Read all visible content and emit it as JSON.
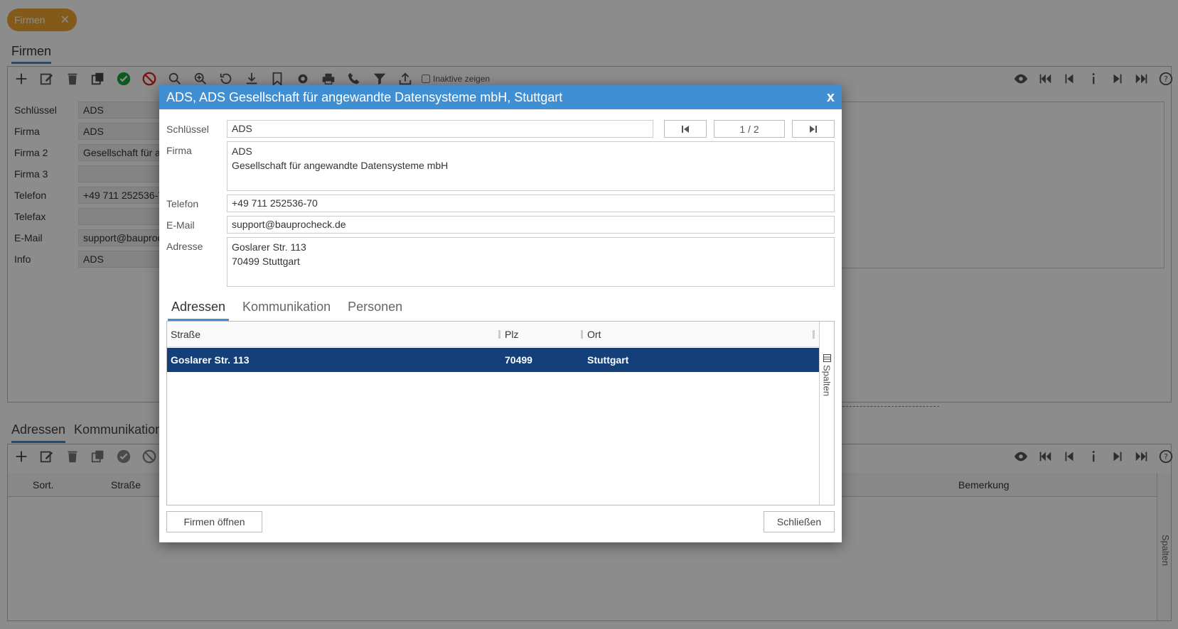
{
  "app": {
    "chip_label": "Firmen",
    "chip_close": "✕",
    "section_title": "Firmen",
    "inactive_label": "Inaktive zeigen",
    "form": [
      {
        "label": "Schlüssel",
        "value": "ADS"
      },
      {
        "label": "Firma",
        "value": "ADS"
      },
      {
        "label": "Firma 2",
        "value": "Gesellschaft für a"
      },
      {
        "label": "Firma 3",
        "value": ""
      },
      {
        "label": "Telefon",
        "value": "+49 711 252536-7"
      },
      {
        "label": "Telefax",
        "value": ""
      },
      {
        "label": "E-Mail",
        "value": "support@bauproc"
      },
      {
        "label": "Info",
        "value": "ADS"
      }
    ],
    "lower_tabs": [
      "Adressen",
      "Kommunikation"
    ],
    "lower_grid": {
      "col_sort": "Sort.",
      "col_strasse": "Straße",
      "col_bemerkung": "Bemerkung"
    },
    "spalten": "Spalten"
  },
  "modal": {
    "title": "ADS, ADS Gesellschaft für angewandte Datensysteme mbH, Stuttgart",
    "close": "x",
    "fields": {
      "schluessel_label": "Schlüssel",
      "schluessel_value": "ADS",
      "firma_label": "Firma",
      "firma_line1": "ADS",
      "firma_line2": "Gesellschaft für angewandte Datensysteme mbH",
      "telefon_label": "Telefon",
      "telefon_value": "+49 711 252536-70",
      "email_label": "E-Mail",
      "email_value": "support@bauprocheck.de",
      "adresse_label": "Adresse",
      "adresse_line1": "Goslarer Str. 113",
      "adresse_line2": "70499 Stuttgart"
    },
    "pager": "1 / 2",
    "tabs": [
      "Adressen",
      "Kommunikation",
      "Personen"
    ],
    "grid": {
      "columns": [
        "Straße",
        "Plz",
        "Ort"
      ],
      "rows": [
        {
          "strasse": "Goslarer Str. 113",
          "plz": "70499",
          "ort": "Stuttgart"
        }
      ],
      "side_label": "Spalten"
    },
    "buttons": {
      "open": "Firmen öffnen",
      "close": "Schließen"
    }
  }
}
